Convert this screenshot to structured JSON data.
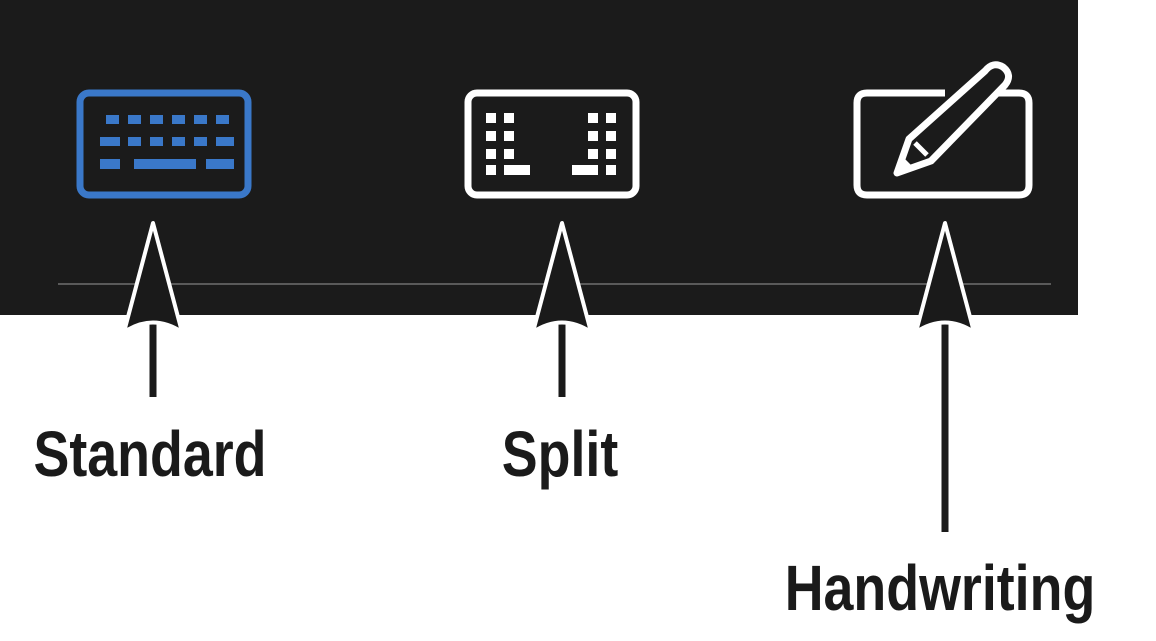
{
  "keyboard_bar": {
    "background_color": "#1b1b1b",
    "active_color": "#3a78c9",
    "inactive_color": "#ffffff",
    "buttons": [
      {
        "id": "standard",
        "icon": "standard-keyboard-icon",
        "active": true
      },
      {
        "id": "split",
        "icon": "split-keyboard-icon",
        "active": false
      },
      {
        "id": "handwriting",
        "icon": "handwriting-pen-icon",
        "active": false
      }
    ]
  },
  "callouts": {
    "standard": "Standard",
    "split": "Split",
    "handwriting": "Handwriting"
  }
}
